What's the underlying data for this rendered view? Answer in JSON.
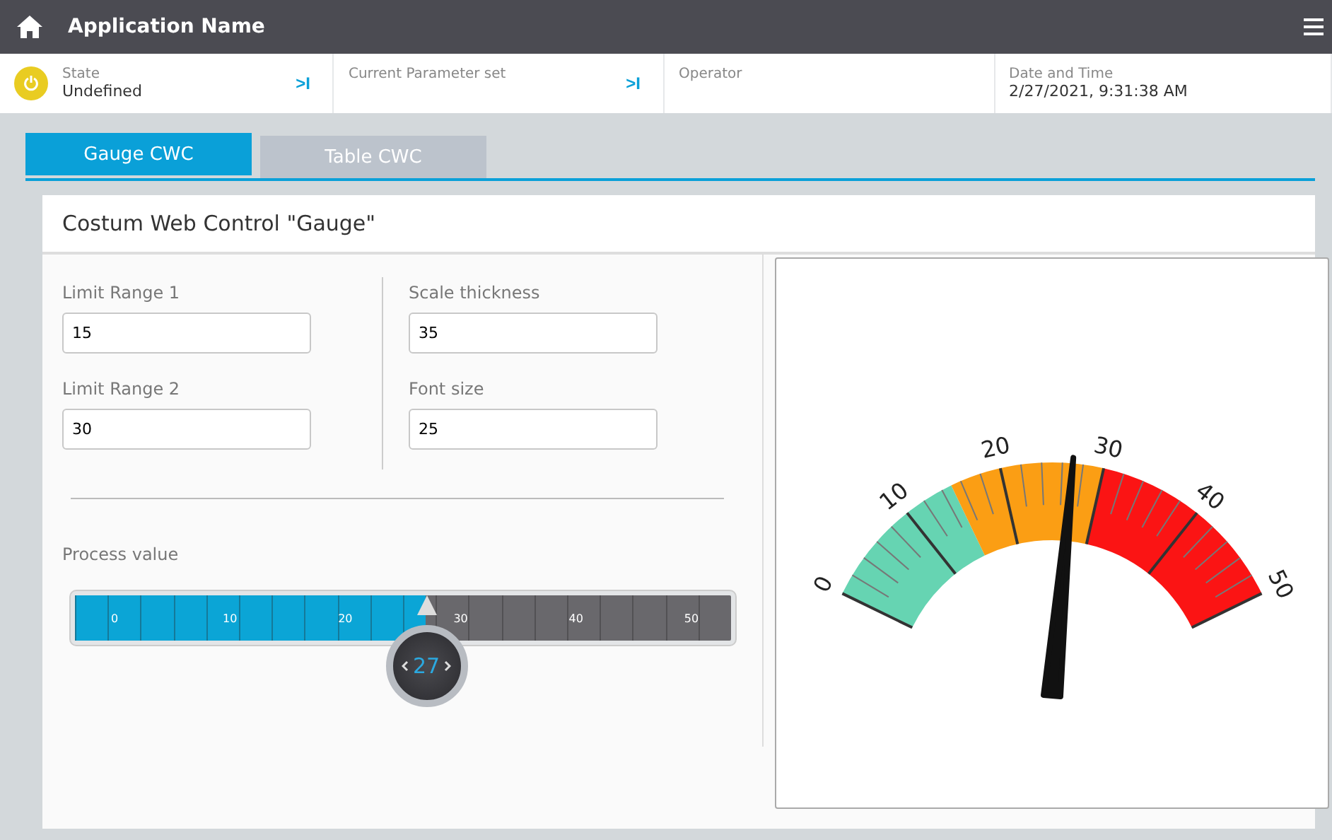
{
  "header": {
    "title": "Application Name"
  },
  "status_bar": [
    {
      "kind": "state",
      "label": "State",
      "value": "Undefined",
      "jump": ">I"
    },
    {
      "kind": "plain",
      "label": "Current Parameter set",
      "jump": ">I"
    },
    {
      "kind": "plain",
      "label": "Operator"
    },
    {
      "kind": "plain",
      "label": "Date and Time",
      "value": "2/27/2021, 9:31:38 AM"
    }
  ],
  "tabs": [
    {
      "label": "Gauge CWC",
      "selected": true
    },
    {
      "label": "Table CWC",
      "selected": false
    }
  ],
  "panel": {
    "title": "Costum Web Control \"Gauge\""
  },
  "fields": [
    {
      "label": "Limit Range 1",
      "value": "15"
    },
    {
      "label": "Scale thickness",
      "value": "35"
    },
    {
      "label": "Limit Range 2",
      "value": "30"
    },
    {
      "label": "Font size",
      "value": "25"
    }
  ],
  "process_value": {
    "label": "Process value",
    "level": 0.54,
    "reading": "27",
    "scale_labels": [
      "0",
      "10",
      "20",
      "30",
      "40",
      "50"
    ]
  },
  "gauge": {
    "scale_labels": [
      "0",
      "10",
      "20",
      "30",
      "40",
      "50"
    ],
    "level": 0.54
  }
}
